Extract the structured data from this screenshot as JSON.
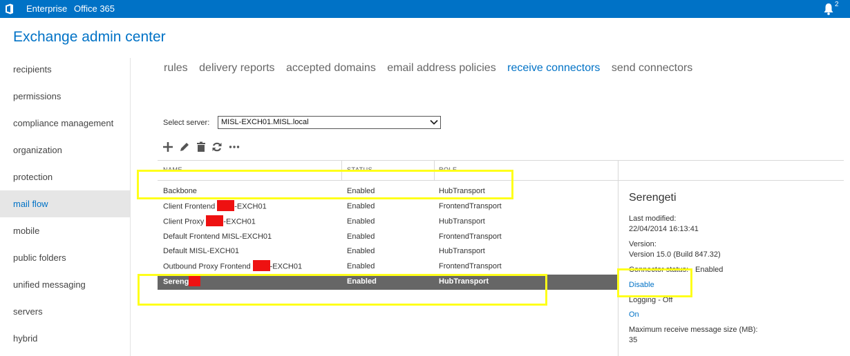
{
  "topbar": {
    "logo_icon": "office-logo-icon",
    "links": [
      "Enterprise",
      "Office 365"
    ],
    "notification_icon": "bell-icon",
    "notification_count": "2",
    "color": "#0072c6"
  },
  "app": {
    "title": "Exchange admin center"
  },
  "sidebar": {
    "items": [
      {
        "label": "recipients",
        "active": false
      },
      {
        "label": "permissions",
        "active": false
      },
      {
        "label": "compliance management",
        "active": false
      },
      {
        "label": "organization",
        "active": false
      },
      {
        "label": "protection",
        "active": false
      },
      {
        "label": "mail flow",
        "active": true
      },
      {
        "label": "mobile",
        "active": false
      },
      {
        "label": "public folders",
        "active": false
      },
      {
        "label": "unified messaging",
        "active": false
      },
      {
        "label": "servers",
        "active": false
      },
      {
        "label": "hybrid",
        "active": false
      }
    ]
  },
  "tabs": [
    {
      "label": "rules",
      "active": false
    },
    {
      "label": "delivery reports",
      "active": false
    },
    {
      "label": "accepted domains",
      "active": false
    },
    {
      "label": "email address policies",
      "active": false
    },
    {
      "label": "receive connectors",
      "active": true
    },
    {
      "label": "send connectors",
      "active": false
    }
  ],
  "server": {
    "label": "Select server:",
    "value": "MISL-EXCH01.MISL.local"
  },
  "toolbar": {
    "icons": [
      "add-icon",
      "edit-icon",
      "delete-icon",
      "refresh-icon",
      "more-icon"
    ]
  },
  "table": {
    "columns": [
      "NAME",
      "STATUS",
      "ROLE"
    ],
    "rows": [
      {
        "name": "Backbone",
        "status": "Enabled",
        "role": "HubTransport",
        "selected": false
      },
      {
        "name": "Client Frontend ",
        "name_suffix": "-EXCH01",
        "status": "Enabled",
        "role": "FrontendTransport",
        "selected": false
      },
      {
        "name": "Client Proxy ",
        "name_suffix": "-EXCH01",
        "status": "Enabled",
        "role": "HubTransport",
        "selected": false
      },
      {
        "name": "Default Frontend MISL-EXCH01",
        "status": "Enabled",
        "role": "FrontendTransport",
        "selected": false
      },
      {
        "name": "Default MISL-EXCH01",
        "status": "Enabled",
        "role": "HubTransport",
        "selected": false
      },
      {
        "name": "Outbound Proxy Frontend ",
        "name_suffix": "-EXCH01",
        "status": "Enabled",
        "role": "FrontendTransport",
        "selected": false
      },
      {
        "name": "Sereng",
        "status": "Enabled",
        "role": "HubTransport",
        "selected": true
      }
    ]
  },
  "detail": {
    "title": "Serengeti",
    "last_modified_label": "Last modified:",
    "last_modified_value": "22/04/2014 16:13:41",
    "version_label": "Version:",
    "version_value": "Version 15.0 (Build 847.32)",
    "status_label": "Connector status:",
    "status_value": "Enabled",
    "disable_link": "Disable",
    "logging_label": "Logging - Off",
    "on_link": "On",
    "max_size_label": "Maximum receive message size (MB):",
    "max_size_value": "35"
  },
  "colors": {
    "accent": "#0072c6",
    "highlight": "#ffff1a",
    "redaction": "#ee1111",
    "selected_row": "#666666"
  }
}
